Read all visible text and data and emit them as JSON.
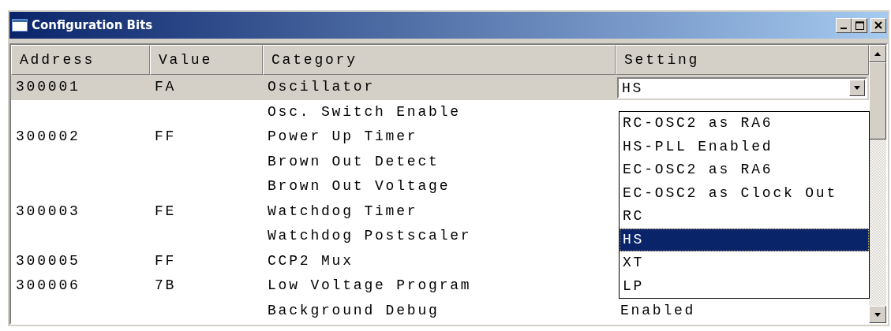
{
  "window": {
    "title": "Configuration Bits"
  },
  "table": {
    "columns": [
      "Address",
      "Value",
      "Category",
      "Setting"
    ],
    "rows": [
      {
        "address": "300001",
        "value": "FA",
        "category": "Oscillator",
        "selected": true,
        "setting": {
          "value": "HS",
          "expanded": true,
          "options": [
            {
              "label": "RC-OSC2 as RA6",
              "selected": false
            },
            {
              "label": "HS-PLL Enabled",
              "selected": false
            },
            {
              "label": "EC-OSC2 as RA6",
              "selected": false
            },
            {
              "label": "EC-OSC2 as Clock Out",
              "selected": false
            },
            {
              "label": "RC",
              "selected": false
            },
            {
              "label": "HS",
              "selected": true
            },
            {
              "label": "XT",
              "selected": false
            },
            {
              "label": "LP",
              "selected": false
            }
          ]
        }
      },
      {
        "category": "Osc. Switch Enable",
        "selected": false
      },
      {
        "address": "300002",
        "value": "FF",
        "category": "Power Up Timer",
        "selected": false
      },
      {
        "category": "Brown Out Detect",
        "selected": false
      },
      {
        "category": "Brown Out Voltage",
        "selected": false
      },
      {
        "address": "300003",
        "value": "FE",
        "category": "Watchdog Timer",
        "selected": false
      },
      {
        "category": "Watchdog Postscaler",
        "selected": false
      },
      {
        "address": "300005",
        "value": "FF",
        "category": "CCP2 Mux",
        "selected": false
      },
      {
        "address": "300006",
        "value": "7B",
        "category": "Low Voltage Program",
        "selected": false
      },
      {
        "category": "Background Debug",
        "setting": "Enabled",
        "selected": false
      }
    ]
  }
}
